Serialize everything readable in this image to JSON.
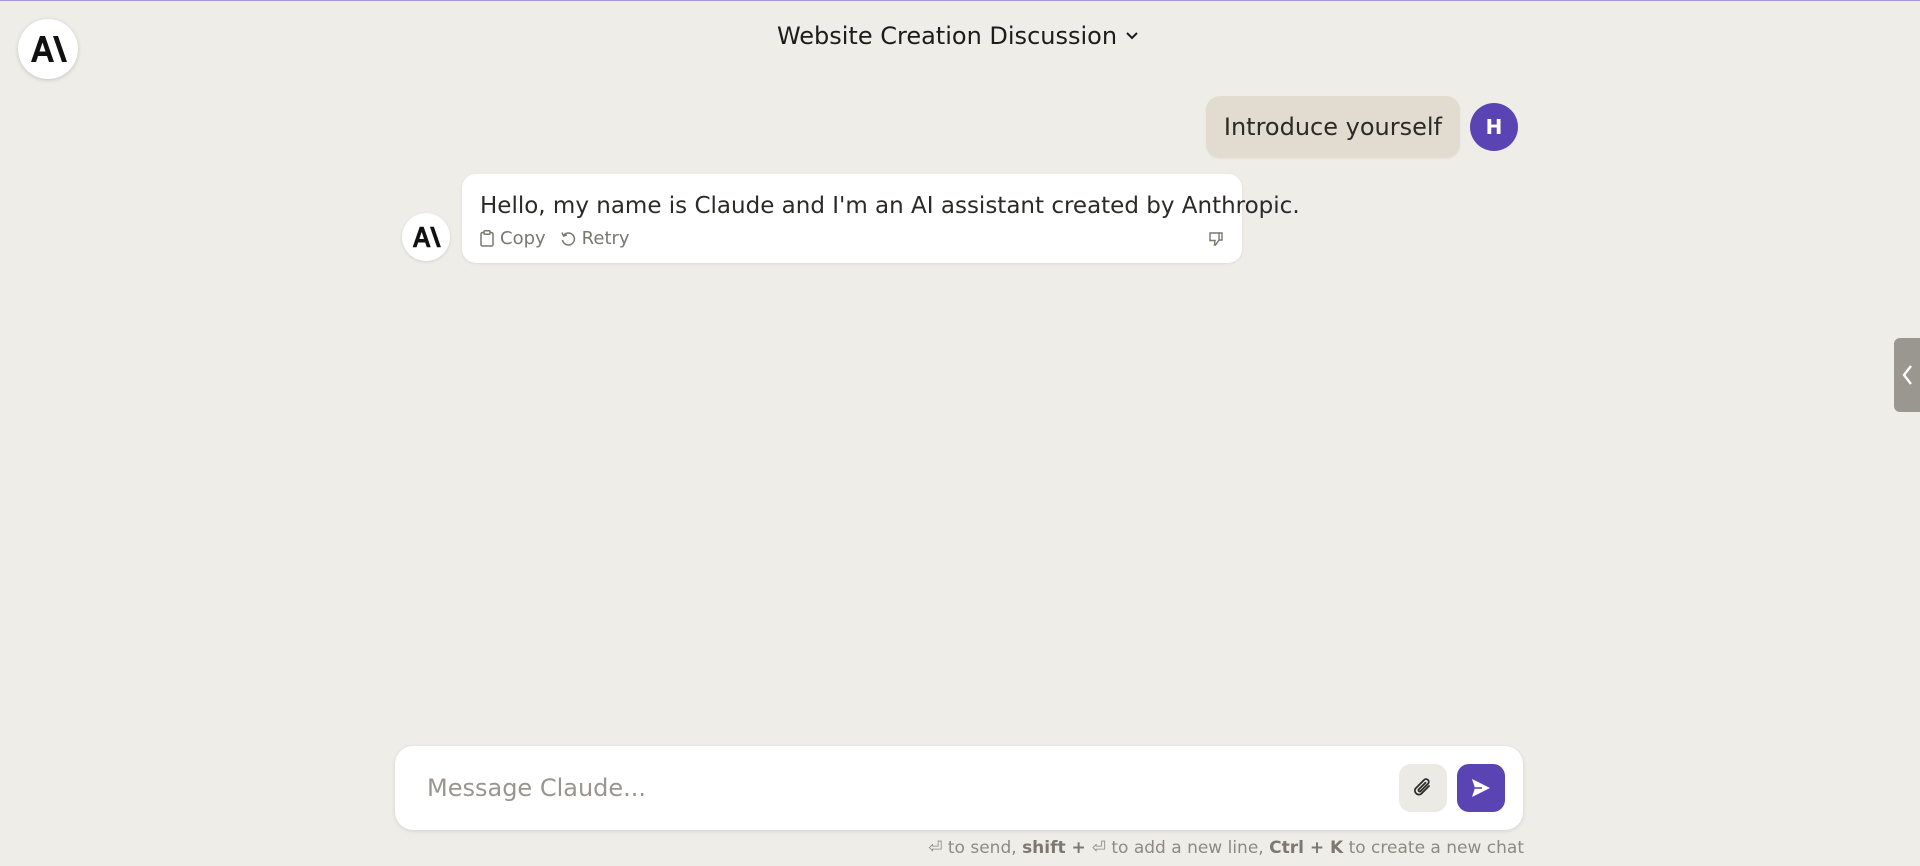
{
  "header": {
    "logo_icon": "anthropic-logo-icon",
    "conversation_title": "Website Creation Discussion",
    "dropdown_icon": "chevron-down-icon"
  },
  "messages": {
    "human": {
      "text": "Introduce yourself",
      "avatar_letter": "H",
      "avatar_color": "#5a44b3"
    },
    "assistant": {
      "text": "Hello, my name is Claude and I'm an AI assistant created by Anthropic.",
      "actions": {
        "copy_label": "Copy",
        "retry_label": "Retry"
      }
    }
  },
  "composer": {
    "placeholder": "Message Claude...",
    "attach_icon": "paperclip-icon",
    "send_icon": "send-icon"
  },
  "hint": {
    "part1": " to send, ",
    "shift_label": "shift + ",
    "part2": " to add a new line, ",
    "ctrlk_label": "Ctrl + K",
    "part3": " to create a new chat",
    "enter_symbol": "⏎"
  },
  "colors": {
    "background": "#efede7",
    "accent": "#5a44b3",
    "human_bubble": "#e2dbd0"
  }
}
